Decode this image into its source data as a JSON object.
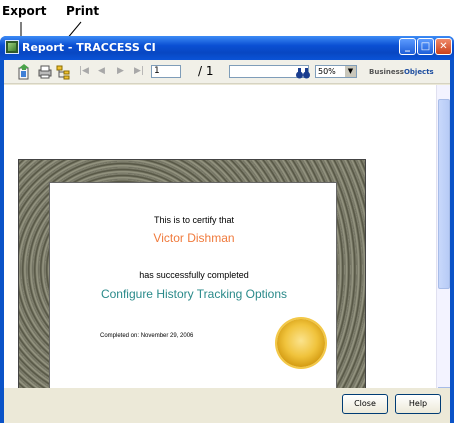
{
  "callouts": {
    "export": "Export",
    "print": "Print"
  },
  "window": {
    "title": "Report - TRACCESS CI"
  },
  "toolbar": {
    "page_value": "1",
    "page_total": "/ 1",
    "zoom_value": "50%",
    "brand_prefix": "Business",
    "brand_suffix": "Objects"
  },
  "certificate": {
    "line1": "This is to certify that",
    "name": "Victor Dishman",
    "line2": "has successfully completed",
    "course": "Configure History Tracking Options",
    "completed": "Completed on: November 29, 2006"
  },
  "footer": {
    "close_label": "Close",
    "help_label": "Help"
  },
  "colors": {
    "title_blue": "#0a53c8",
    "name_orange": "#f07a3c",
    "course_teal": "#2a8a8a",
    "seal_gold": "#f0c33c"
  },
  "icons": [
    "export-icon",
    "print-icon",
    "tree-icon",
    "first-page-icon",
    "prev-page-icon",
    "next-page-icon",
    "last-page-icon",
    "binoculars-icon",
    "minimize-icon",
    "maximize-icon",
    "close-icon"
  ]
}
